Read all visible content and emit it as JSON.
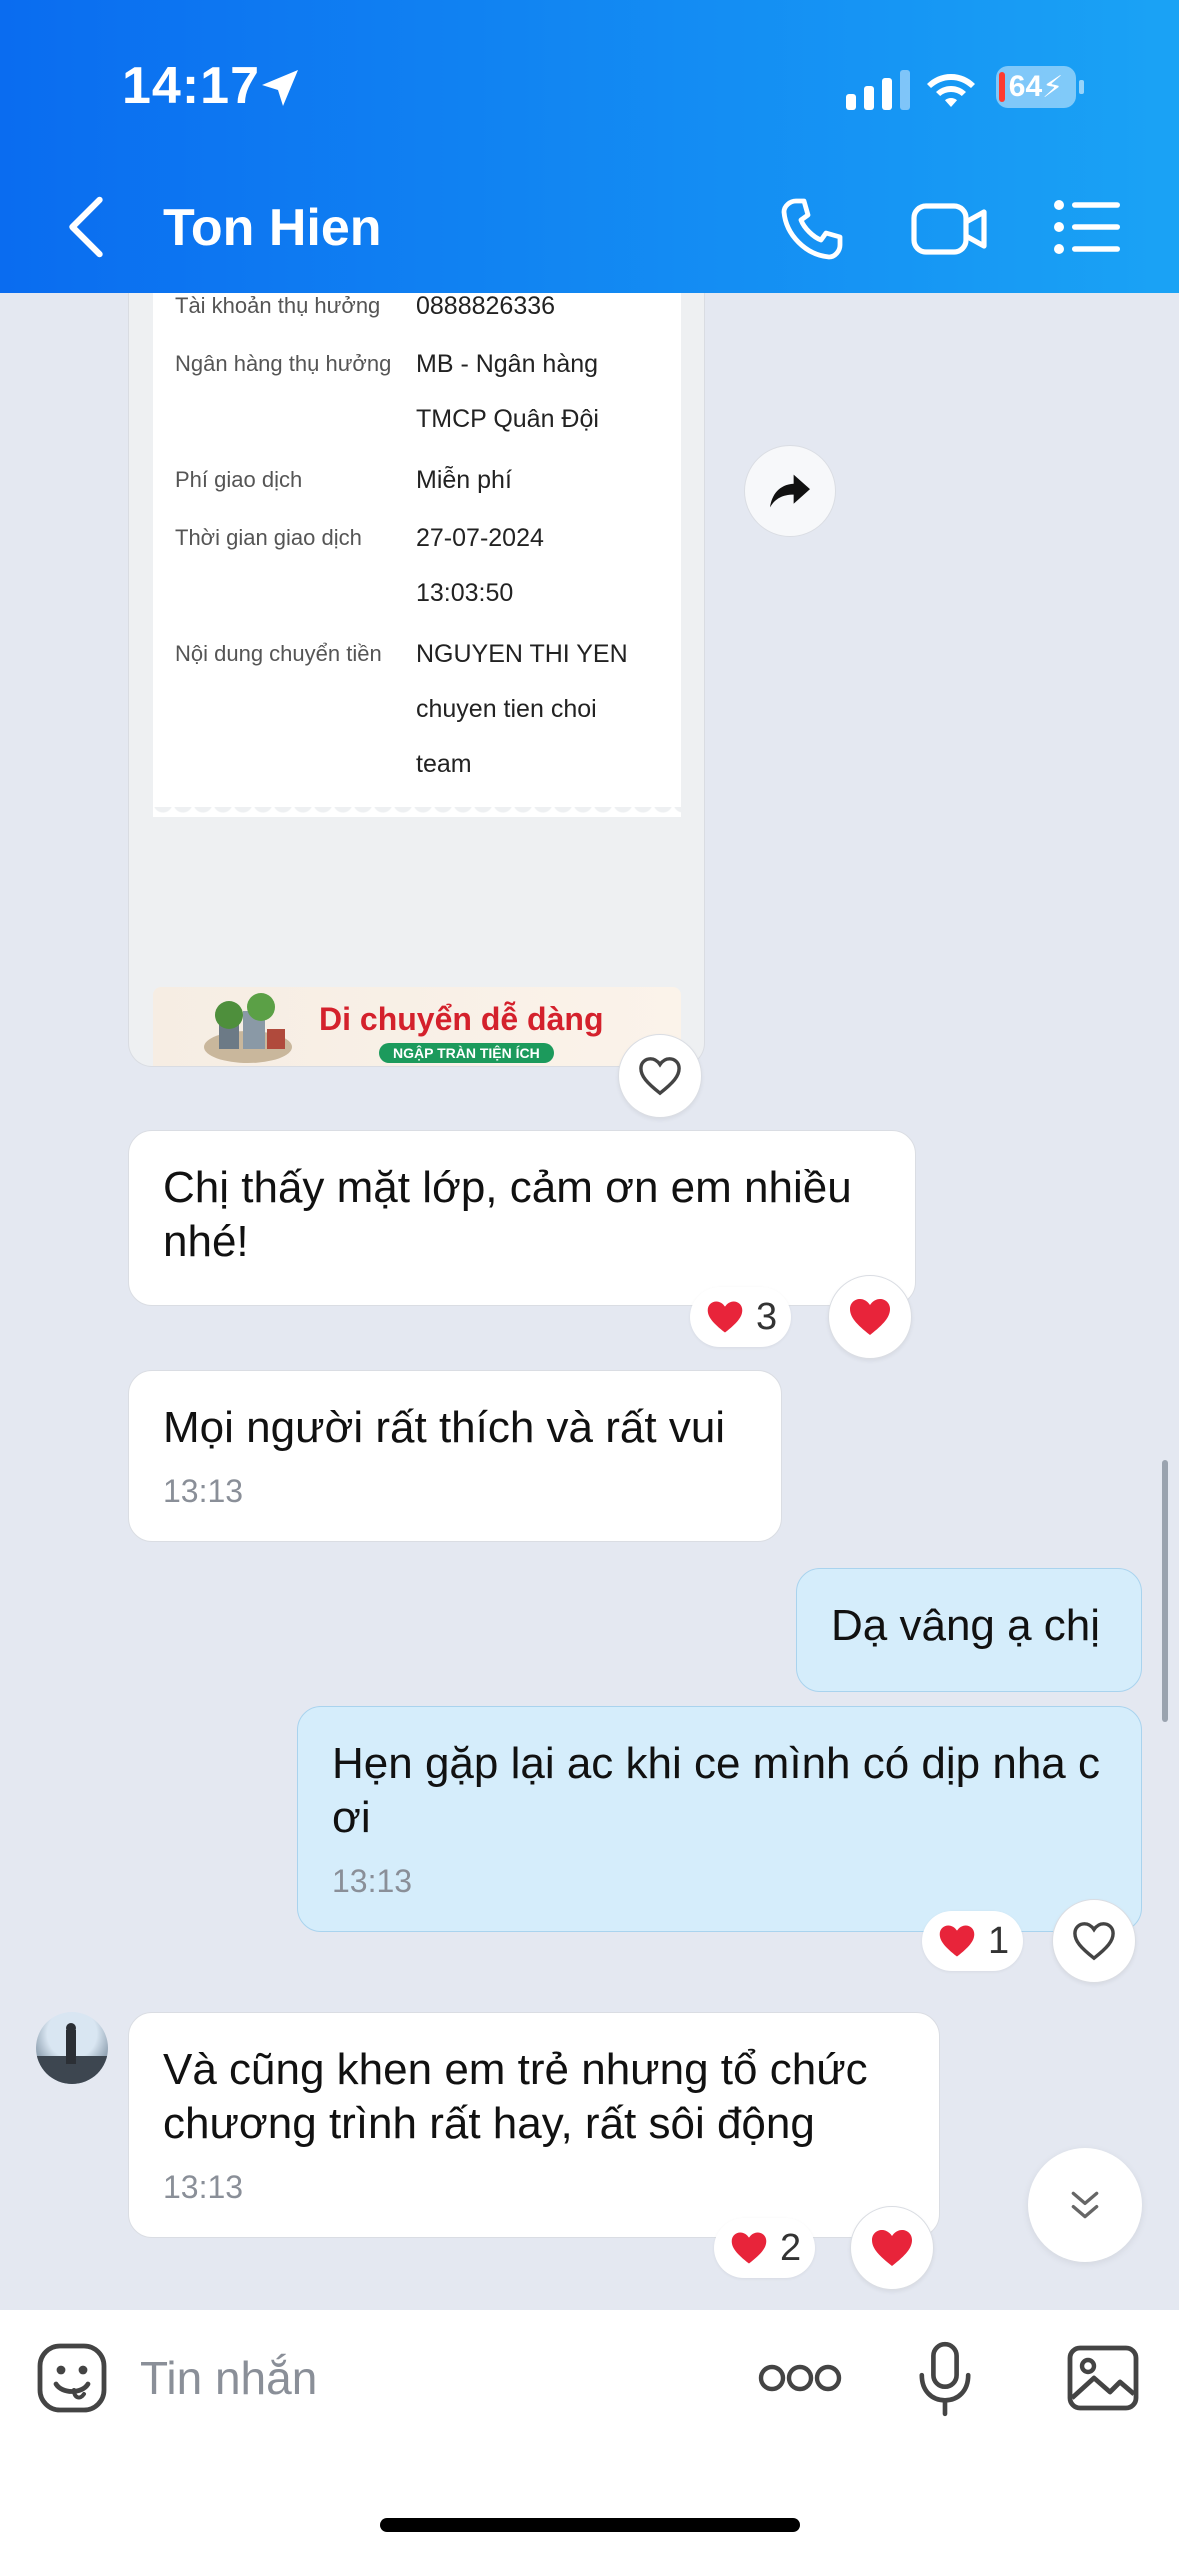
{
  "status_bar": {
    "time": "14:17",
    "battery": "64"
  },
  "header": {
    "title": "Ton Hien"
  },
  "receipt": {
    "rows": [
      {
        "label": "Tài khoản thụ hưởng",
        "value": "0888826336"
      },
      {
        "label": "Ngân hàng thụ hưởng",
        "value": "MB - Ngân hàng TMCP Quân Đội"
      },
      {
        "label": "Phí giao dịch",
        "value": "Miễn phí"
      },
      {
        "label": "Thời gian giao dịch",
        "value": "27-07-2024 13:03:50"
      },
      {
        "label": "Nội dung chuyển tiền",
        "value": "NGUYEN THI YEN chuyen tien choi team"
      }
    ],
    "banner_title": "Di chuyển dễ dàng",
    "banner_sub": "NGẬP TRÀN TIỆN ÍCH"
  },
  "messages": [
    {
      "text": "Chị thấy mặt lớp, cảm ơn em nhiều nhé!",
      "reaction_count": "3"
    },
    {
      "text": "Mọi người rất thích và rất vui",
      "time": "13:13"
    },
    {
      "text": "Dạ vâng ạ chị"
    },
    {
      "text": "Hẹn gặp lại ac khi ce mình có dịp nha c ơi",
      "time": "13:13",
      "reaction_count": "1"
    },
    {
      "text": "Và cũng khen em trẻ nhưng tổ chức chương trình rất hay, rất sôi động",
      "time": "13:13",
      "reaction_count": "2"
    }
  ],
  "input": {
    "placeholder": "Tin nhắn"
  },
  "colors": {
    "header_start": "#0A6CF0",
    "header_end": "#1AA3F5",
    "my_bubble": "#D5EDFB",
    "heart": "#E8243A"
  }
}
